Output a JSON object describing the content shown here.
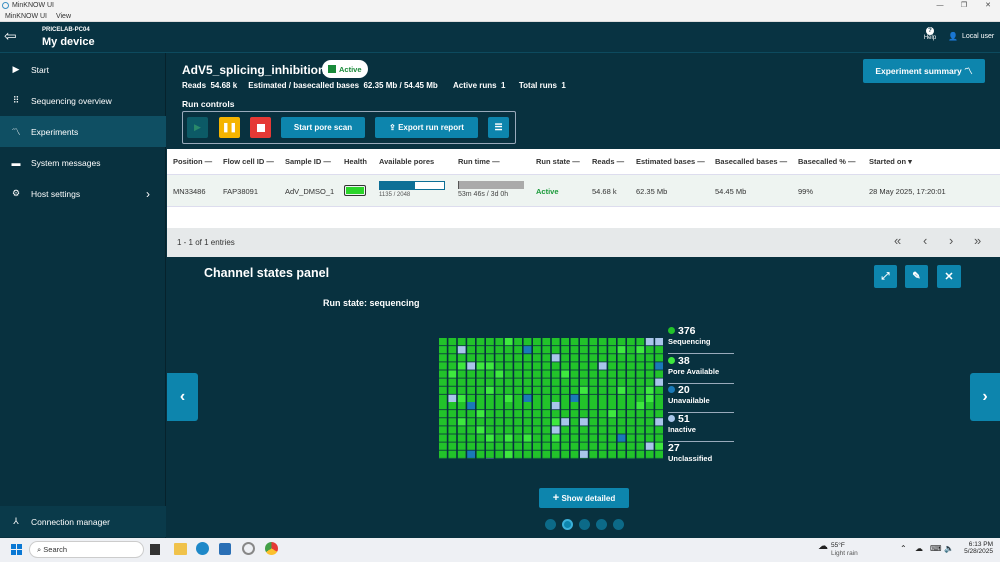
{
  "window": {
    "title": "MinKNOW UI",
    "menu": [
      "MinKNOW UI",
      "View"
    ]
  },
  "header": {
    "host": "PRICELAB-PC04",
    "device": "My device",
    "help": "Help",
    "user": "Local user"
  },
  "sidebar": {
    "items": [
      {
        "label": "Start",
        "icon": "play-circle-icon"
      },
      {
        "label": "Sequencing overview",
        "icon": "grid-icon"
      },
      {
        "label": "Experiments",
        "icon": "trend-icon"
      },
      {
        "label": "System messages",
        "icon": "message-icon"
      },
      {
        "label": "Host settings",
        "icon": "gear-icon"
      }
    ],
    "connection_manager": "Connection manager"
  },
  "experiment": {
    "name": "AdV5_splicing_inhibition",
    "status": "Active",
    "reads_label": "Reads",
    "reads_value": "54.68 k",
    "bases_label": "Estimated / basecalled bases",
    "bases_value": "62.35 Mb / 54.45 Mb",
    "active_runs_label": "Active runs",
    "active_runs_value": "1",
    "total_runs_label": "Total runs",
    "total_runs_value": "1",
    "summary_button": "Experiment summary"
  },
  "run_controls": {
    "title": "Run controls",
    "start_pore_scan": "Start pore scan",
    "export_run_report": "Export run report"
  },
  "table": {
    "headers": [
      "Position",
      "Flow cell ID",
      "Sample ID",
      "Health",
      "Available pores",
      "Run time",
      "Run state",
      "Reads",
      "Estimated bases",
      "Basecalled bases",
      "Basecalled %",
      "Started on"
    ],
    "row": {
      "position": "MN33486",
      "flow_cell": "FAP38091",
      "sample": "AdV_DMSO_1",
      "pores": "1135 / 2048",
      "pores_fraction": 0.554,
      "run_time": "53m 46s / 3d 0h",
      "run_time_fraction": 0.012,
      "state": "Active",
      "reads": "54.68 k",
      "est_bases": "62.35 Mb",
      "basecalled": "54.45 Mb",
      "basecalled_pct": "99%",
      "started": "28 May 2025, 17:20:01"
    },
    "entries": "1 - 1 of 1 entries"
  },
  "channel_panel": {
    "title": "Channel states panel",
    "run_state": "Run state: sequencing",
    "legend": [
      {
        "count": "376",
        "label": "Sequencing",
        "color": "#22c32a"
      },
      {
        "count": "38",
        "label": "Pore Available",
        "color": "#3ee83e"
      },
      {
        "count": "20",
        "label": "Unavailable",
        "color": "#1a7ab8"
      },
      {
        "count": "51",
        "label": "Inactive",
        "color": "#a9c6ea"
      },
      {
        "count": "27",
        "label": "Unclassified",
        "color": "#0f3d4c"
      }
    ],
    "show_detailed": "Show detailed"
  },
  "taskbar": {
    "search": "Search",
    "weather_temp": "55°F",
    "weather_desc": "Light rain",
    "time": "6:13 PM",
    "date": "5/28/2025"
  }
}
